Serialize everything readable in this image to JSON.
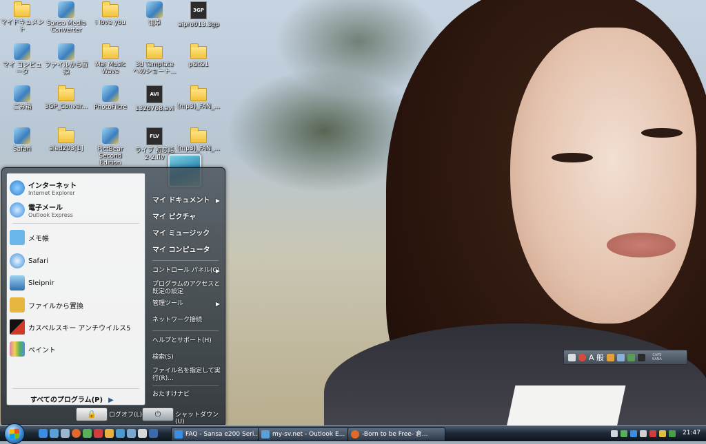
{
  "desktop": {
    "icons": [
      {
        "label": "マイドキュメント",
        "kind": "folder"
      },
      {
        "label": "Sansa Media Converter",
        "kind": "app"
      },
      {
        "label": "i love you",
        "kind": "folder"
      },
      {
        "label": "電卓",
        "kind": "app"
      },
      {
        "label": "aipro013.3gp",
        "kind": "file",
        "badge": "3GP"
      },
      {
        "label": "マイ コンピュータ",
        "kind": "app"
      },
      {
        "label": "ファイルから置換",
        "kind": "app"
      },
      {
        "label": "Mai Music Wave",
        "kind": "folder"
      },
      {
        "label": "3d Template へのショート...",
        "kind": "folder"
      },
      {
        "label": "p&t&1",
        "kind": "folder"
      },
      {
        "label": "ごみ箱",
        "kind": "app"
      },
      {
        "label": "3GP_Conver...",
        "kind": "folder"
      },
      {
        "label": "PhotoFiltre",
        "kind": "app"
      },
      {
        "label": "1326768.avi",
        "kind": "file",
        "badge": "AVI"
      },
      {
        "label": "(mp3)_FAN_...",
        "kind": "folder"
      },
      {
        "label": "Safari",
        "kind": "app"
      },
      {
        "label": "aled203[1]",
        "kind": "folder"
      },
      {
        "label": "PictBear Second Edition",
        "kind": "app"
      },
      {
        "label": "ライブ 初恋話 2-2.flv",
        "kind": "file",
        "badge": "FLV"
      },
      {
        "label": "(mp3)_FAN_...",
        "kind": "folder"
      }
    ]
  },
  "start_menu": {
    "pinned": [
      {
        "title": "インターネット",
        "subtitle": "Internet Explorer",
        "color": "#2f7fd1"
      },
      {
        "title": "電子メール",
        "subtitle": "Outlook Express",
        "color": "#3a8de0"
      }
    ],
    "recent": [
      {
        "title": "メモ帳",
        "color": "#6bb6e8"
      },
      {
        "title": "Safari",
        "color": "#3f8fd6"
      },
      {
        "title": "Sleipnir",
        "color": "#4aa1d8"
      },
      {
        "title": "ファイルから置換",
        "color": "#e6b640"
      },
      {
        "title": "カスペルスキー アンチウイルス5",
        "color": "#d03a2a"
      },
      {
        "title": "ペイント",
        "color": "#e07bb0"
      }
    ],
    "all_programs": "すべてのプログラム(P)",
    "right": {
      "my_documents": "マイ ドキュメント",
      "my_pictures": "マイ ピクチャ",
      "my_music": "マイ ミュージック",
      "my_computer": "マイ コンピュータ",
      "control_panel": "コントロール パネル(C)",
      "program_access": "プログラムのアクセスと既定の設定",
      "admin_tools": "管理ツール",
      "network": "ネットワーク接続",
      "help": "ヘルプとサポート(H)",
      "search": "検索(S)",
      "run": "ファイル名を指定して実行(R)...",
      "recommended": "おたすけナビ"
    },
    "logoff": "ログオフ(L)",
    "shutdown": "シャットダウン(U)"
  },
  "langbar": {
    "mode": "A 般",
    "caps": "CAPS",
    "kana": "KANA"
  },
  "taskbar": {
    "tasks": [
      {
        "label": "FAQ - Sansa e200 Seri...",
        "color": "#3a8de0"
      },
      {
        "label": "my-sv.net - Outlook E...",
        "color": "#5aa0d8"
      },
      {
        "label": "-Born to be Free- 倉...",
        "color": "#e06a2a"
      }
    ],
    "clock": "21:47"
  }
}
